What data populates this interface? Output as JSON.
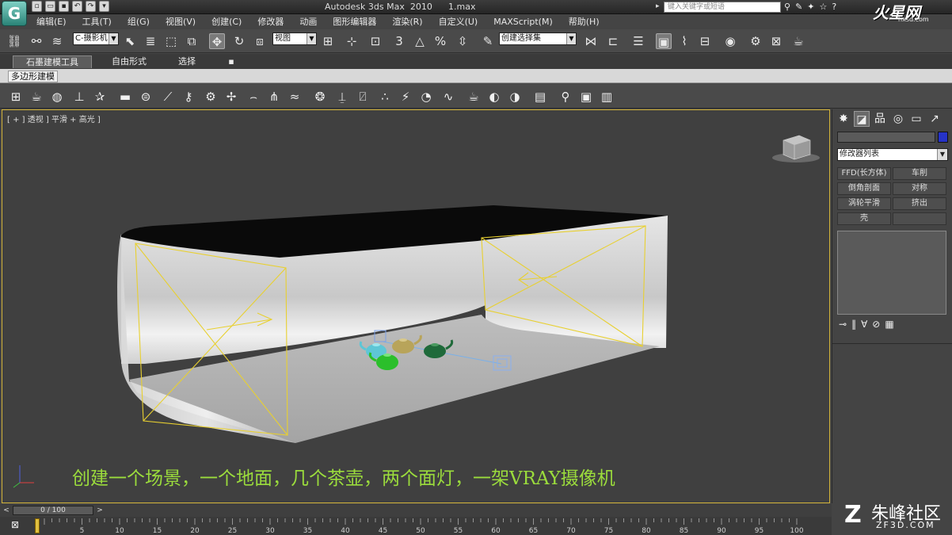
{
  "titlebar": {
    "logo": "G",
    "app_title": "Autodesk 3ds Max  2010",
    "file_name": "1.max",
    "search_placeholder": "键入关键字或短语",
    "brand": "火星网",
    "brand_sub": "hxsd.com"
  },
  "menu": [
    "编辑(E)",
    "工具(T)",
    "组(G)",
    "视图(V)",
    "创建(C)",
    "修改器",
    "动画",
    "图形编辑器",
    "渲染(R)",
    "自定义(U)",
    "MAXScript(M)",
    "帮助(H)"
  ],
  "toolbar": {
    "selection_filter": "C-摄影机",
    "reference_coord": "视图",
    "named_selection": "创建选择集",
    "snap_3": "3",
    "snap_percent": "%"
  },
  "ribbon": {
    "tabs": [
      "石墨建模工具",
      "自由形式",
      "选择"
    ],
    "panel_tab": "多边形建模"
  },
  "viewport": {
    "label": "[ + ] 透视 ] 平滑 + 高光 ]",
    "caption": "创建一个场景，一个地面，几个茶壶，两个面灯，一架VRAY摄像机"
  },
  "command_panel": {
    "modifier_list": "修改器列表",
    "buttons": [
      "FFD(长方体)",
      "车削",
      "倒角剖面",
      "对称",
      "涡轮平滑",
      "挤出",
      "壳",
      ""
    ]
  },
  "timeline": {
    "frame": "0 / 100",
    "ticks": [
      "5",
      "10",
      "15",
      "20",
      "25",
      "30",
      "35",
      "40",
      "45",
      "50",
      "55",
      "60",
      "65",
      "70",
      "75",
      "80",
      "85",
      "90",
      "95",
      "100"
    ]
  },
  "watermark": {
    "name": "朱峰社区",
    "url": "ZF3D.COM"
  },
  "colors": {
    "viewport_border": "#d4b43a",
    "caption": "#9bdc3c",
    "light_wire": "#e8d030",
    "object_color": "#2633c7"
  }
}
